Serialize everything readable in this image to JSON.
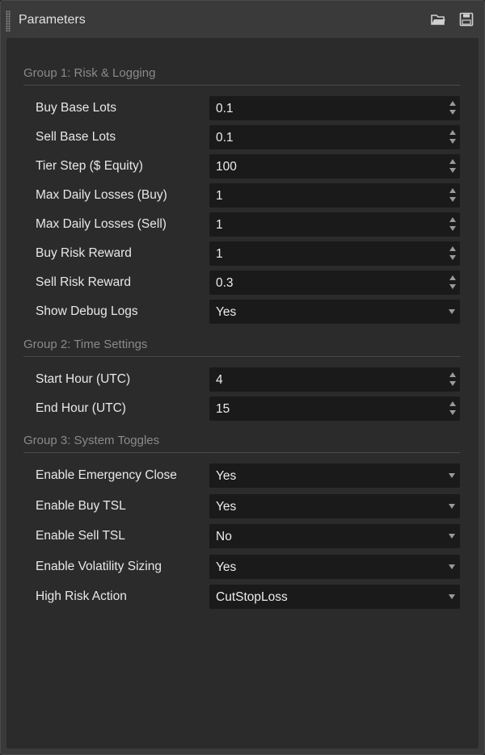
{
  "window": {
    "title": "Parameters"
  },
  "toolbar": {
    "open_icon": "folder-open-icon",
    "save_icon": "floppy-save-icon"
  },
  "groups": [
    {
      "title": "Group 1: Risk & Logging"
    },
    {
      "title": "Group 2: Time Settings"
    },
    {
      "title": "Group 3: System Toggles"
    }
  ],
  "params": [
    {
      "label": "Buy Base Lots",
      "value": "0.1",
      "kind": "number"
    },
    {
      "label": "Sell Base Lots",
      "value": "0.1",
      "kind": "number"
    },
    {
      "label": "Tier Step ($ Equity)",
      "value": "100",
      "kind": "number"
    },
    {
      "label": "Max Daily Losses (Buy)",
      "value": "1",
      "kind": "number"
    },
    {
      "label": "Max Daily Losses (Sell)",
      "value": "1",
      "kind": "number"
    },
    {
      "label": "Buy Risk Reward",
      "value": "1",
      "kind": "number"
    },
    {
      "label": "Sell Risk Reward",
      "value": "0.3",
      "kind": "number"
    },
    {
      "label": "Show Debug Logs",
      "value": "Yes",
      "kind": "select"
    },
    {
      "label": "Start Hour (UTC)",
      "value": "4",
      "kind": "number"
    },
    {
      "label": "End Hour (UTC)",
      "value": "15",
      "kind": "number"
    },
    {
      "label": "Enable Emergency Close",
      "value": "Yes",
      "kind": "select"
    },
    {
      "label": "Enable Buy TSL",
      "value": "Yes",
      "kind": "select"
    },
    {
      "label": "Enable Sell TSL",
      "value": "No",
      "kind": "select"
    },
    {
      "label": "Enable Volatility Sizing",
      "value": "Yes",
      "kind": "select"
    },
    {
      "label": "High Risk Action",
      "value": "CutStopLoss",
      "kind": "select"
    }
  ]
}
